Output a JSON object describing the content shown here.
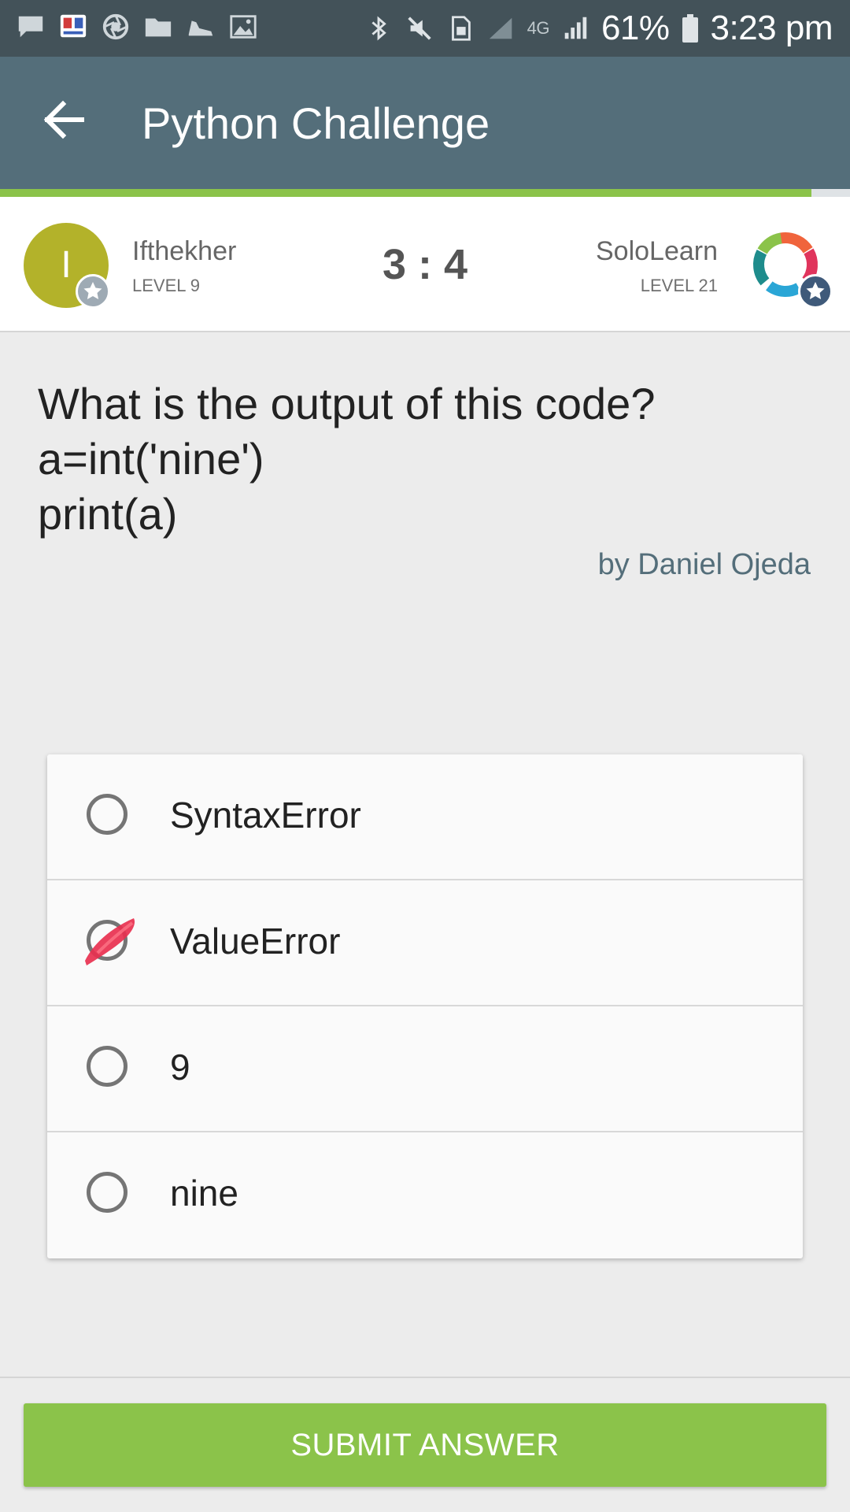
{
  "status_bar": {
    "left_icons": [
      "message-icon",
      "app-icon",
      "aperture-icon",
      "folder-icon",
      "shoe-icon",
      "image-icon"
    ],
    "right_icons": [
      "bluetooth-icon",
      "mute-icon",
      "sim-icon",
      "signal-icon",
      "lte-icon",
      "signal-icon"
    ],
    "network": "4G",
    "battery": "61%",
    "time": "3:23 pm"
  },
  "app_bar": {
    "title": "Python Challenge",
    "back_icon": "arrow-left-icon",
    "progress_fraction": 0.955
  },
  "players": {
    "left": {
      "initial": "I",
      "name": "Ifthekher",
      "level": "LEVEL 9"
    },
    "score": "3 : 4",
    "right": {
      "name": "SoloLearn",
      "level": "LEVEL 21"
    }
  },
  "question": {
    "lines": [
      "What is the output of this code?",
      "a=int('nine')",
      "print(a)"
    ],
    "author": "by Daniel Ojeda"
  },
  "answers": [
    {
      "label": "SyntaxError",
      "selected": false
    },
    {
      "label": "ValueError",
      "selected": true
    },
    {
      "label": "9",
      "selected": false
    },
    {
      "label": "nine",
      "selected": false
    }
  ],
  "submit_label": "SUBMIT ANSWER",
  "colors": {
    "status_bar": "#435259",
    "app_bar": "#546e7a",
    "accent_green": "#8bc34a",
    "avatar_left": "#b3b22a",
    "author_text": "#546e7a",
    "selection_mark": "#e8304f"
  }
}
